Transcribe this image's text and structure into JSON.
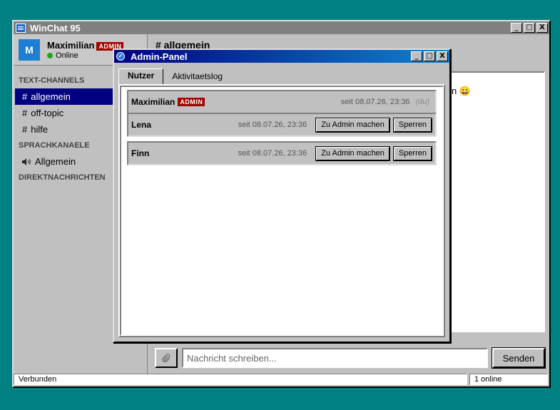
{
  "window": {
    "title": "WinChat 95",
    "min": "_",
    "max": "□",
    "close": "X"
  },
  "profile": {
    "avatar_letter": "M",
    "name": "Maximilian",
    "badge": "ADMIN",
    "status": "Online"
  },
  "sidebar": {
    "text_header": "TEXT-CHANNELS",
    "text_channels": [
      {
        "hash": "#",
        "label": "allgemein",
        "active": true
      },
      {
        "hash": "#",
        "label": "off-topic"
      },
      {
        "hash": "#",
        "label": "hilfe"
      }
    ],
    "voice_header": "SPRACHKANAELE",
    "voice_channels": [
      {
        "icon": "speaker-icon",
        "label": "Allgemein"
      }
    ],
    "dm_header": "DIREKTNACHRICHTEN"
  },
  "main": {
    "channel_title": "# allgemein",
    "peek_text": "n",
    "peek_emoji": "😀",
    "input_placeholder": "Nachricht schreiben...",
    "send_label": "Senden"
  },
  "statusbar": {
    "left": "Verbunden",
    "right": "1 online"
  },
  "dialog": {
    "title": "Admin-Panel",
    "tabs": [
      {
        "label": "Nutzer",
        "active": true
      },
      {
        "label": "Aktivitaetslog"
      }
    ],
    "users": [
      {
        "name": "Maximilian",
        "badge": "ADMIN",
        "since": "seit 08.07.26, 23:36",
        "self": "(du)"
      },
      {
        "name": "Lena",
        "since": "seit 08.07.26, 23:36",
        "promote": "Zu Admin machen",
        "ban": "Sperren"
      },
      {
        "name": "Finn",
        "since": "seit 08.07.26, 23:36",
        "promote": "Zu Admin machen",
        "ban": "Sperren"
      }
    ]
  },
  "colors": {
    "desktop": "#008080",
    "selection": "#000080",
    "admin_badge": "#a40000",
    "online": "#1aa81a"
  }
}
